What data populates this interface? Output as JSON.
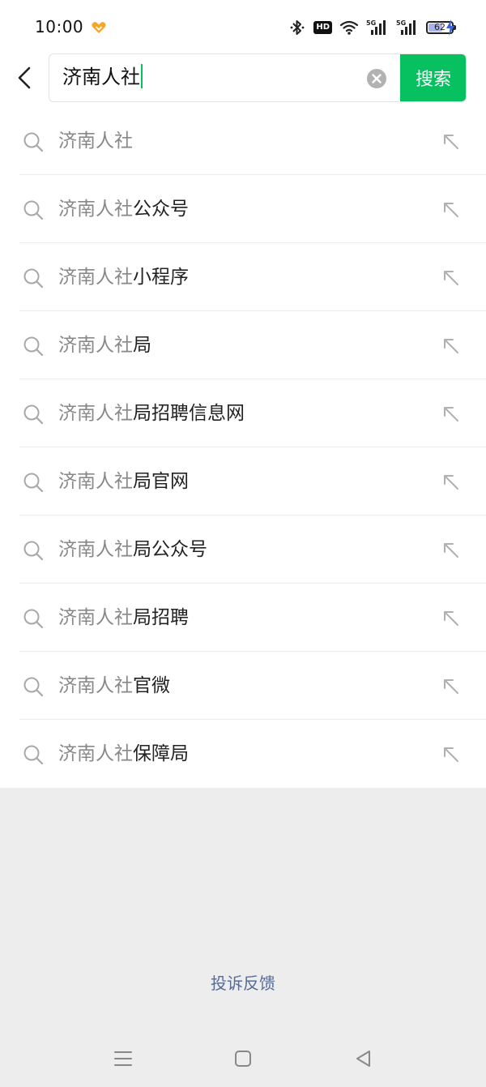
{
  "status_bar": {
    "time": "10:00",
    "battery_level": "62",
    "battery_fraction": 0.62,
    "icons": [
      "app-heart-icon",
      "bluetooth-icon",
      "hd-icon",
      "wifi-icon",
      "signal-5g-icon",
      "signal-5g-icon",
      "battery-icon",
      "charging-icon"
    ],
    "hd_label": "HD"
  },
  "search": {
    "query": "济南人社",
    "button_label": "搜索",
    "accent_color": "#07c160"
  },
  "suggestions": [
    {
      "match": "济南人社",
      "rest": ""
    },
    {
      "match": "济南人社",
      "rest": "公众号"
    },
    {
      "match": "济南人社",
      "rest": "小程序"
    },
    {
      "match": "济南人社",
      "rest": "局"
    },
    {
      "match": "济南人社",
      "rest": "局招聘信息网"
    },
    {
      "match": "济南人社",
      "rest": "局官网"
    },
    {
      "match": "济南人社",
      "rest": "局公众号"
    },
    {
      "match": "济南人社",
      "rest": "局招聘"
    },
    {
      "match": "济南人社",
      "rest": "官微"
    },
    {
      "match": "济南人社",
      "rest": "保障局"
    }
  ],
  "footer": {
    "feedback_label": "投诉反馈",
    "link_color": "#576b95"
  },
  "nav_bar": {
    "buttons": [
      "menu-icon",
      "home-icon",
      "back-triangle-icon"
    ]
  }
}
